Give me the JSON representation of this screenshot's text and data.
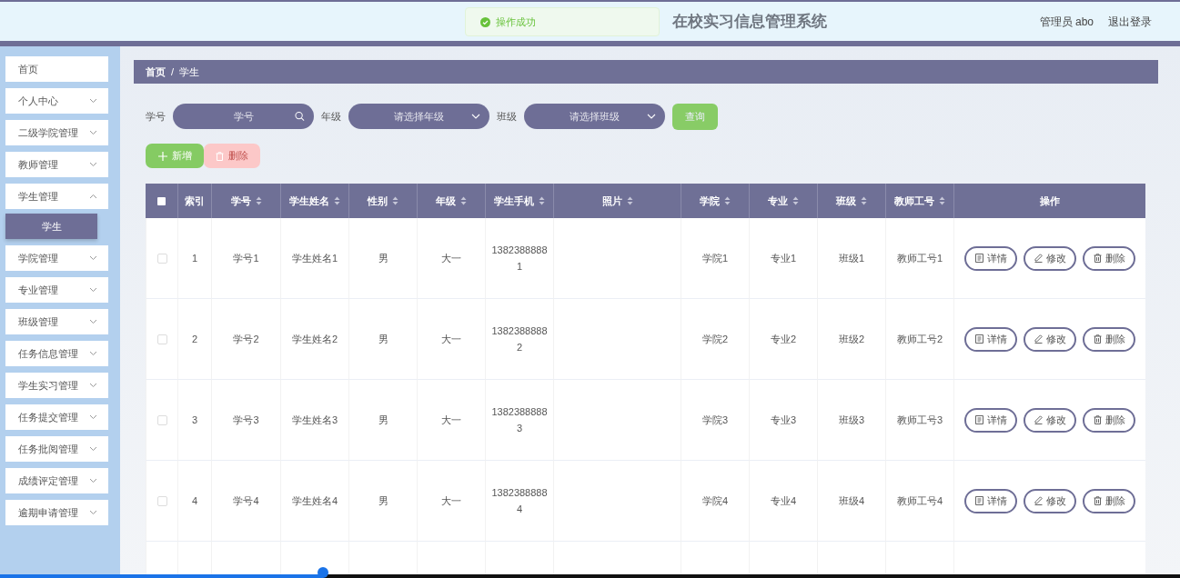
{
  "header": {
    "title": "在校实习信息管理系统",
    "user": "管理员 abo",
    "logout": "退出登录"
  },
  "toast": {
    "text": "操作成功"
  },
  "sidebar": {
    "items": [
      {
        "label": "首页",
        "kind": "link"
      },
      {
        "label": "个人中心",
        "kind": "menu",
        "expanded": false
      },
      {
        "label": "二级学院管理",
        "kind": "menu",
        "expanded": false
      },
      {
        "label": "教师管理",
        "kind": "menu",
        "expanded": false
      },
      {
        "label": "学生管理",
        "kind": "menu",
        "expanded": true,
        "children": [
          {
            "label": "学生",
            "selected": true
          }
        ]
      },
      {
        "label": "学院管理",
        "kind": "menu",
        "expanded": false
      },
      {
        "label": "专业管理",
        "kind": "menu",
        "expanded": false
      },
      {
        "label": "班级管理",
        "kind": "menu",
        "expanded": false
      },
      {
        "label": "任务信息管理",
        "kind": "menu",
        "expanded": false
      },
      {
        "label": "学生实习管理",
        "kind": "menu",
        "expanded": false
      },
      {
        "label": "任务提交管理",
        "kind": "menu",
        "expanded": false
      },
      {
        "label": "任务批阅管理",
        "kind": "menu",
        "expanded": false
      },
      {
        "label": "成绩评定管理",
        "kind": "menu",
        "expanded": false
      },
      {
        "label": "逾期申请管理",
        "kind": "menu",
        "expanded": false
      }
    ]
  },
  "breadcrumb": [
    "首页",
    "/",
    "学生"
  ],
  "filters": [
    {
      "label": "学号",
      "kind": "search",
      "placeholder": "学号"
    },
    {
      "label": "年级",
      "kind": "select",
      "placeholder": "请选择年级"
    },
    {
      "label": "班级",
      "kind": "select",
      "placeholder": "请选择班级"
    }
  ],
  "query_button": "查询",
  "actions": [
    {
      "label": "新增",
      "kind": "add",
      "disabled": false
    },
    {
      "label": "删除",
      "kind": "delete",
      "disabled": true
    }
  ],
  "table": {
    "select_all": {
      "checked": false
    },
    "columns": [
      {
        "label": "索引",
        "sortable": false
      },
      {
        "label": "学号",
        "sortable": true
      },
      {
        "label": "学生姓名",
        "sortable": true
      },
      {
        "label": "性别",
        "sortable": true
      },
      {
        "label": "年级",
        "sortable": true
      },
      {
        "label": "学生手机",
        "sortable": true
      },
      {
        "label": "照片",
        "sortable": true
      },
      {
        "label": "学院",
        "sortable": true
      },
      {
        "label": "专业",
        "sortable": true
      },
      {
        "label": "班级",
        "sortable": true
      },
      {
        "label": "教师工号",
        "sortable": true
      },
      {
        "label": "操作",
        "sortable": false
      }
    ],
    "rows": [
      {
        "checked": false,
        "cells": [
          "1",
          "学号1",
          "学生姓名1",
          "男",
          "大一",
          "13823888881",
          "",
          "学院1",
          "专业1",
          "班级1",
          "教师工号1"
        ],
        "actions": [
          {
            "label": "详情",
            "kind": "detail"
          },
          {
            "label": "修改",
            "kind": "edit"
          },
          {
            "label": "删除",
            "kind": "delete"
          }
        ]
      },
      {
        "checked": false,
        "cells": [
          "2",
          "学号2",
          "学生姓名2",
          "男",
          "大一",
          "13823888882",
          "",
          "学院2",
          "专业2",
          "班级2",
          "教师工号2"
        ],
        "actions": [
          {
            "label": "详情",
            "kind": "detail"
          },
          {
            "label": "修改",
            "kind": "edit"
          },
          {
            "label": "删除",
            "kind": "delete"
          }
        ]
      },
      {
        "checked": false,
        "cells": [
          "3",
          "学号3",
          "学生姓名3",
          "男",
          "大一",
          "13823888883",
          "",
          "学院3",
          "专业3",
          "班级3",
          "教师工号3"
        ],
        "actions": [
          {
            "label": "详情",
            "kind": "detail"
          },
          {
            "label": "修改",
            "kind": "edit"
          },
          {
            "label": "删除",
            "kind": "delete"
          }
        ]
      },
      {
        "checked": false,
        "cells": [
          "4",
          "学号4",
          "学生姓名4",
          "男",
          "大一",
          "13823888884",
          "",
          "学院4",
          "专业4",
          "班级4",
          "教师工号4"
        ],
        "actions": [
          {
            "label": "详情",
            "kind": "detail"
          },
          {
            "label": "修改",
            "kind": "edit"
          },
          {
            "label": "删除",
            "kind": "delete"
          }
        ]
      }
    ]
  },
  "player": {
    "level": 0.274
  }
}
